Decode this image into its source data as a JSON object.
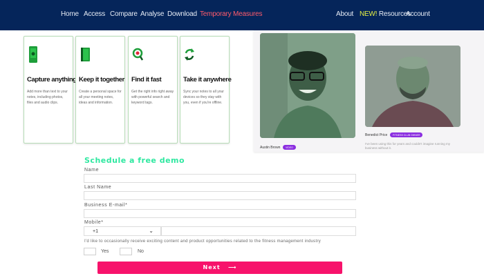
{
  "nav": {
    "left_items": [
      "Home",
      "Access",
      "Compare",
      "Analyse",
      "Download",
      "Temporary Measures"
    ],
    "right_items": [
      "About",
      "Resources",
      "Account"
    ],
    "new_badge": "NEW!",
    "active_color": "#ff5b6b",
    "bg_color": "#05255a"
  },
  "features": [
    {
      "icon": "phone-snapshot-icon",
      "title": "Capture anything",
      "desc": "Add more than text to your notes, including photos, files and audio clips."
    },
    {
      "icon": "notebook-icon",
      "title": "Keep it together",
      "desc": "Create a personal space for all your meeting notes, ideas and information."
    },
    {
      "icon": "magnifier-icon",
      "title": "Find it fast",
      "desc": "Get the right info right away with powerful search and keyword tags."
    },
    {
      "icon": "sync-arrows-icon",
      "title": "Take it anywhere",
      "desc": "Sync your notes to all your devices so they stay with you, even if you're offline."
    }
  ],
  "testimonials": [
    {
      "name": "Austin Brown",
      "tag": "VIDEO"
    },
    {
      "name": "Benedict Price",
      "tag": "FITNESS CLUB OWNER",
      "quote": "I've been using this for years and couldn't imagine running my business without it."
    }
  ],
  "form": {
    "title": "Schedule a free demo",
    "name_label": "Name",
    "last_name_label": "Last Name",
    "email_label": "Business E-mail*",
    "mobile_label": "Mobile*",
    "country_code": "+1",
    "name_value": "",
    "last_name_value": "",
    "email_value": "",
    "mobile_value": "",
    "consent_text": "I'd like to occasionally receive exciting content and product opportunities related to the fitness management industry",
    "yes_label": "Yes",
    "no_label": "No",
    "next_label": "Next",
    "next_arrow": "⟶",
    "accent_color": "#2ee8a0",
    "button_color": "#f7126b"
  }
}
